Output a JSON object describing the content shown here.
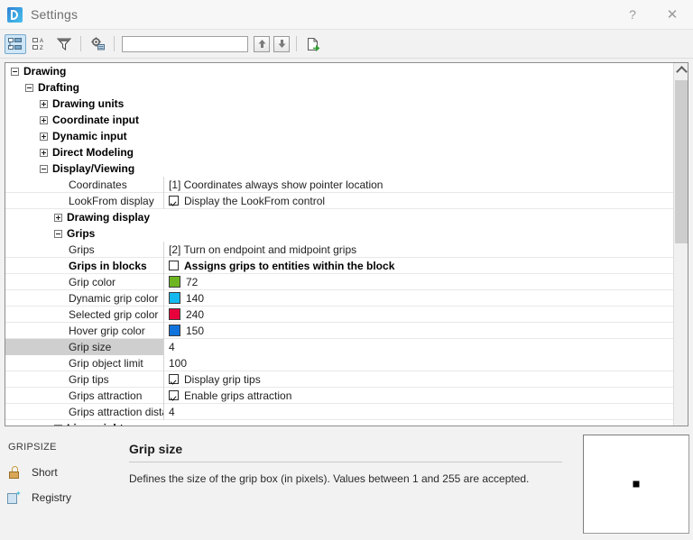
{
  "window": {
    "title": "Settings",
    "app_icon": "bricscad-icon",
    "help_label": "?",
    "close_label": "✕"
  },
  "toolbar": {
    "buttons": [
      {
        "name": "categorized-view-button",
        "icon": "tree-view-icon",
        "active": true
      },
      {
        "name": "alphabetical-view-button",
        "icon": "sort-az-icon",
        "active": false
      },
      {
        "name": "filter-button",
        "icon": "funnel-icon",
        "active": false
      },
      {
        "name": "settings-options-button",
        "icon": "gear-box-icon",
        "active": false
      }
    ],
    "search": {
      "value": "",
      "placeholder": ""
    },
    "nav_prev": {
      "name": "find-previous-button",
      "icon": "arrow-up-icon"
    },
    "nav_next": {
      "name": "find-next-button",
      "icon": "arrow-down-icon"
    },
    "export": {
      "name": "export-button",
      "icon": "export-page-icon"
    }
  },
  "tree": {
    "categories": [
      {
        "label": "Drawing",
        "indent": 0,
        "expanded": true
      },
      {
        "label": "Drafting",
        "indent": 1,
        "expanded": true
      },
      {
        "label": "Drawing units",
        "indent": 2,
        "expanded": false
      },
      {
        "label": "Coordinate input",
        "indent": 2,
        "expanded": false
      },
      {
        "label": "Dynamic input",
        "indent": 2,
        "expanded": false
      },
      {
        "label": "Direct Modeling",
        "indent": 2,
        "expanded": false
      },
      {
        "label": "Display/Viewing",
        "indent": 2,
        "expanded": true
      }
    ],
    "properties_a": [
      {
        "name": "Coordinates",
        "value": "[1] Coordinates always show pointer location",
        "kind": "text",
        "selected": false,
        "bold": false
      },
      {
        "name": "LookFrom display",
        "value": "Display the LookFrom control",
        "kind": "checkbox",
        "checked": true,
        "selected": false,
        "bold": false
      }
    ],
    "subcategories": [
      {
        "label": "Drawing display",
        "indent": 3,
        "expanded": false
      },
      {
        "label": "Grips",
        "indent": 3,
        "expanded": true
      }
    ],
    "properties_b": [
      {
        "name": "Grips",
        "value": "[2] Turn on endpoint and midpoint grips",
        "kind": "text",
        "selected": false,
        "bold": false
      },
      {
        "name": "Grips in blocks",
        "value": "Assigns grips to entities within the block",
        "kind": "checkbox",
        "checked": false,
        "selected": false,
        "bold": true
      },
      {
        "name": "Grip color",
        "value": "72",
        "kind": "color",
        "color": "#6cb521",
        "selected": false,
        "bold": false
      },
      {
        "name": "Dynamic grip color",
        "value": "140",
        "kind": "color",
        "color": "#15b9ef",
        "selected": false,
        "bold": false
      },
      {
        "name": "Selected grip color",
        "value": "240",
        "kind": "color",
        "color": "#e8003c",
        "selected": false,
        "bold": false
      },
      {
        "name": "Hover grip color",
        "value": "150",
        "kind": "color",
        "color": "#1173dc",
        "selected": false,
        "bold": false
      },
      {
        "name": "Grip size",
        "value": "4",
        "kind": "edit",
        "selected": true,
        "bold": false
      },
      {
        "name": "Grip object limit",
        "value": "100",
        "kind": "text",
        "selected": false,
        "bold": false
      },
      {
        "name": "Grip tips",
        "value": "Display grip tips",
        "kind": "checkbox",
        "checked": true,
        "selected": false,
        "bold": false
      },
      {
        "name": "Grips attraction",
        "value": "Enable grips attraction",
        "kind": "checkbox",
        "checked": true,
        "selected": false,
        "bold": false
      },
      {
        "name": "Grips attraction distance",
        "value": "4",
        "kind": "text",
        "selected": false,
        "bold": false
      }
    ],
    "clipped_category": {
      "label": "Lineweights",
      "indent": 3,
      "expanded": false
    }
  },
  "info": {
    "sysvar_name": "GRIPSIZE",
    "links": [
      {
        "label": "Short",
        "icon": "lock-icon"
      },
      {
        "label": "Registry",
        "icon": "registry-icon"
      }
    ],
    "title": "Grip size",
    "description": "Defines the size of the grip box (in pixels). Values between 1 and 255 are accepted.",
    "preview": {
      "name": "grip-preview",
      "grip_pixels": 4
    }
  }
}
